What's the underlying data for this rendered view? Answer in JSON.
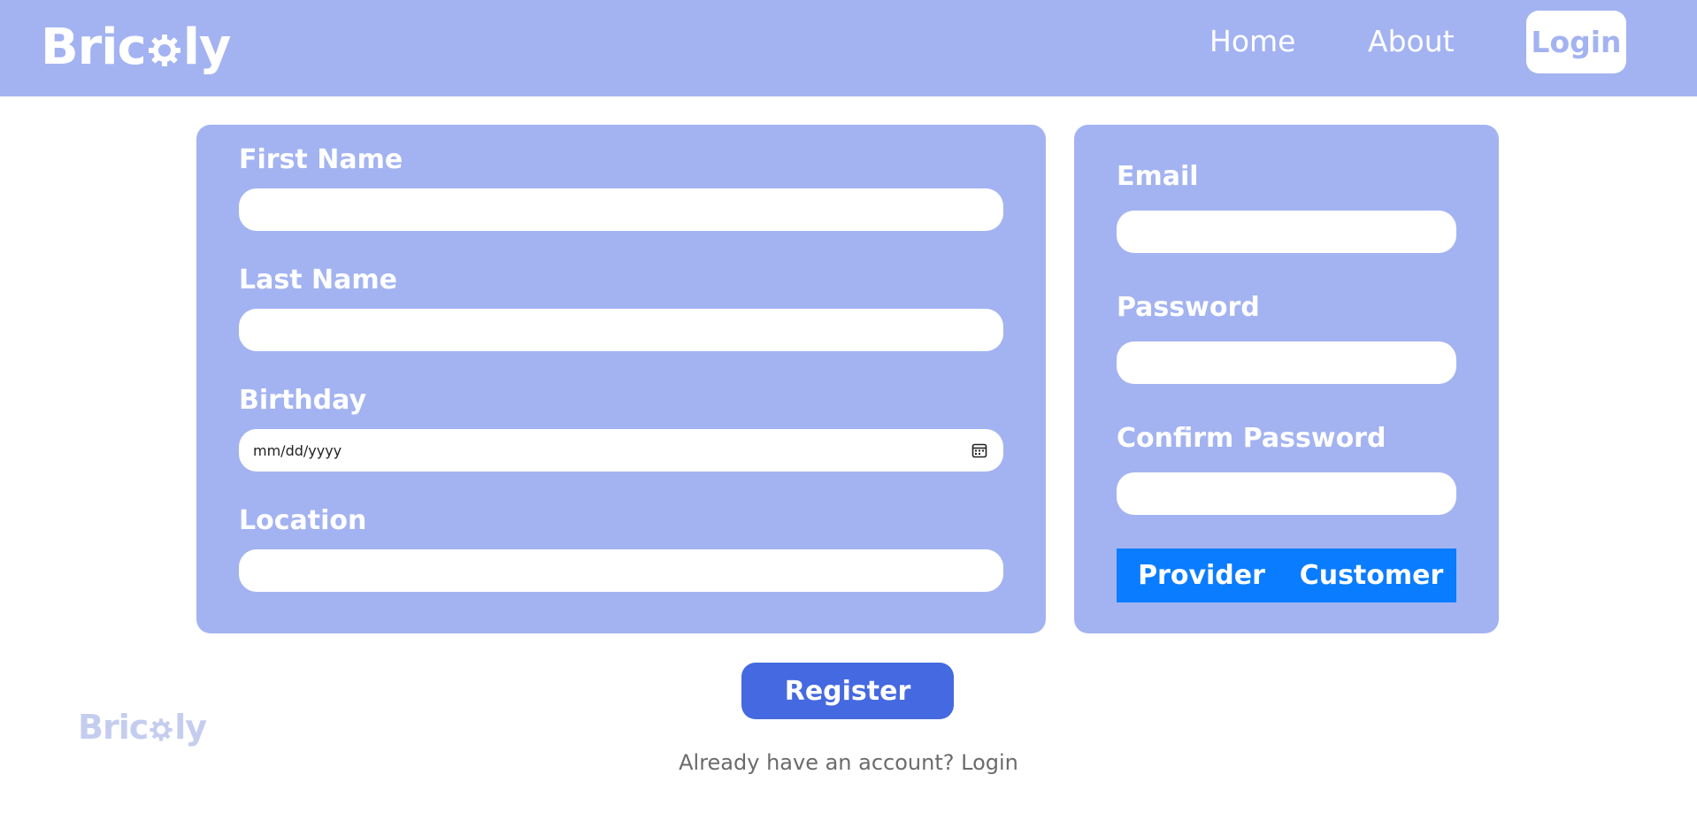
{
  "navbar": {
    "brand_pre": "Bric",
    "brand_post": "ly",
    "links": {
      "home": "Home",
      "about": "About",
      "login": "Login"
    }
  },
  "form_left": {
    "first_name_label": "First Name",
    "last_name_label": "Last Name",
    "birthday_label": "Birthday",
    "birthday_placeholder": "mm/dd/yyyy",
    "location_label": "Location"
  },
  "form_right": {
    "email_label": "Email",
    "password_label": "Password",
    "confirm_password_label": "Confirm Password",
    "role_options": {
      "provider": "Provider",
      "customer": "Customer"
    }
  },
  "actions": {
    "register_label": "Register"
  },
  "footer": {
    "brand_pre": "Bric",
    "brand_post": "ly",
    "already_text": "Already have an account? ",
    "login_link": "Login"
  },
  "colors": {
    "primary": "#a3b3f1",
    "register": "#4469e0",
    "toggle": "#0a7cff"
  },
  "icons": {
    "brand_o": "gear-icon",
    "birthday": "calendar-icon"
  }
}
